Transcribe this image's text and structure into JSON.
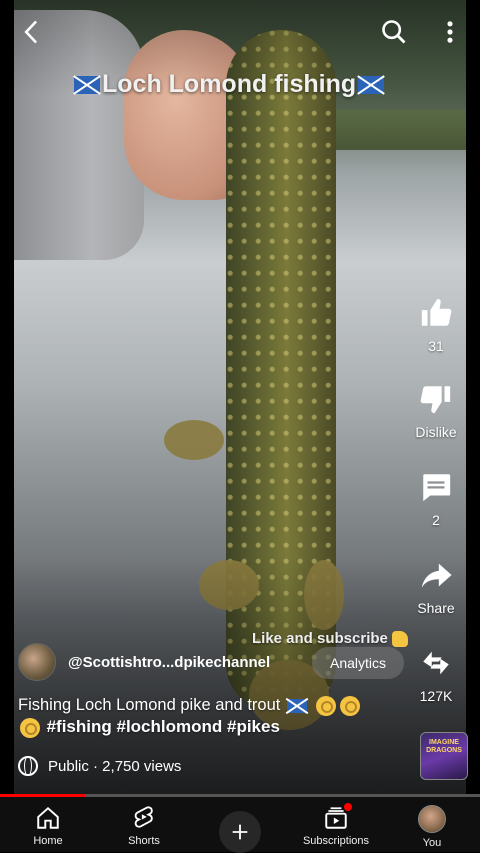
{
  "video": {
    "overlay_title": "Loch Lomond fishing",
    "like_subscribe_text": "Like and subscribe"
  },
  "topbar": {
    "back_icon": "arrow-left-icon",
    "search_icon": "search-icon",
    "more_icon": "more-vert-icon"
  },
  "actions": {
    "like_count": "31",
    "dislike_label": "Dislike",
    "comment_count": "2",
    "share_label": "Share",
    "remix_count": "127K"
  },
  "channel": {
    "handle": "@Scottishtro...dpikechannel",
    "analytics_label": "Analytics"
  },
  "caption": {
    "text": "Fishing Loch Lomond pike and trout",
    "hashtags": "#fishing #lochlomond #pikes"
  },
  "visibility": {
    "label": "Public · 2,750 views"
  },
  "music": {
    "thumb_text": "IMAGINE DRAGONS"
  },
  "progress": {
    "fraction": 0.18
  },
  "nav": {
    "items": [
      {
        "label": "Home",
        "icon": "home-icon"
      },
      {
        "label": "Shorts",
        "icon": "shorts-icon"
      },
      {
        "label": "",
        "icon": "plus-icon"
      },
      {
        "label": "Subscriptions",
        "icon": "subscriptions-icon"
      },
      {
        "label": "You",
        "icon": "avatar"
      }
    ]
  },
  "colors": {
    "accent": "#ff0000",
    "nav_bg": "#0f0f0f"
  }
}
